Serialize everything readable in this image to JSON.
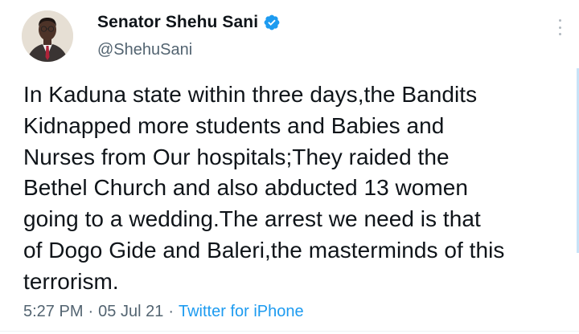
{
  "author": {
    "display_name": "Senator Shehu Sani",
    "handle": "@ShehuSani",
    "verified": true
  },
  "tweet": {
    "text": "In Kaduna state within three days,the Bandits\nKidnapped more students and Babies and\nNurses from Our hospitals;They raided the\nBethel Church and also abducted 13 women\ngoing to a wedding.The arrest we need is that\nof Dogo Gide and Baleri,the masterminds of this\nterrorism."
  },
  "meta": {
    "time": "5:27 PM",
    "sep1": "·",
    "date": "05 Jul 21",
    "sep2": "·",
    "source": "Twitter for iPhone"
  },
  "icons": {
    "verified": "verified-badge-icon",
    "more": "more-vertical-icon"
  },
  "colors": {
    "link": "#1d9bf0",
    "secondary_text": "#536471",
    "primary_text": "#0f1419"
  }
}
